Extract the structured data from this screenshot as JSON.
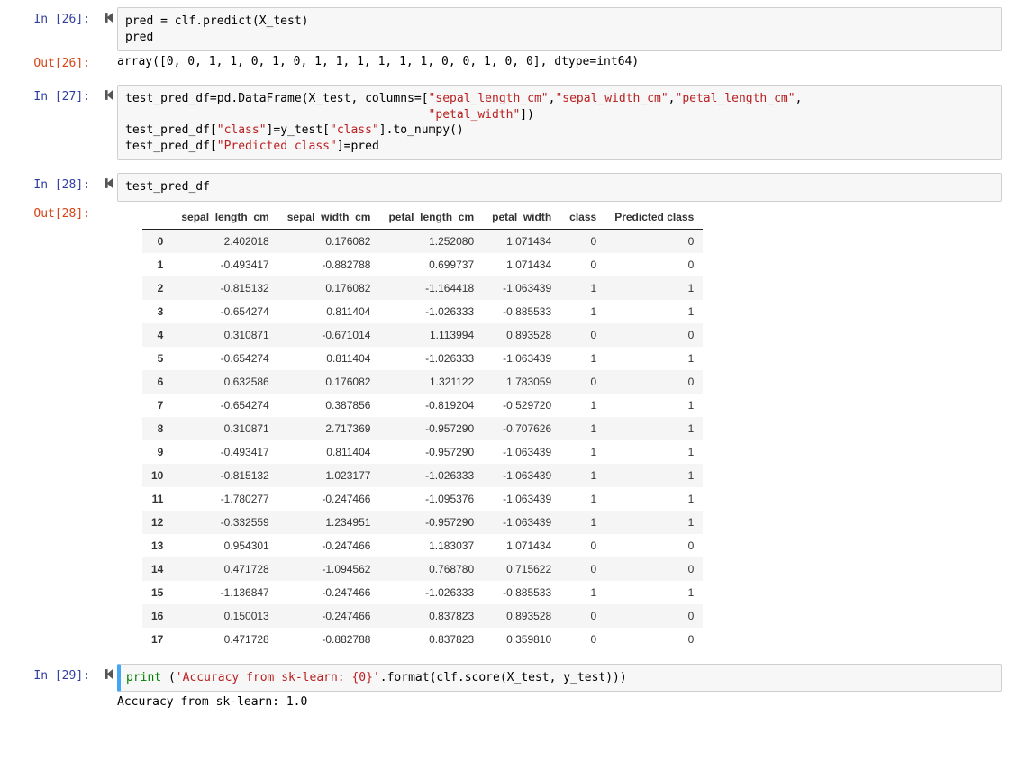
{
  "cells": {
    "c26": {
      "in_prompt": "In [26]:",
      "code_html": "pred = clf.predict(X_test)\npred",
      "out_prompt": "Out[26]:",
      "out_text": "array([0, 0, 1, 1, 0, 1, 0, 1, 1, 1, 1, 1, 1, 0, 0, 1, 0, 0], dtype=int64)"
    },
    "c27": {
      "in_prompt": "In [27]:",
      "code_html": "test_pred_df=pd.DataFrame(X_test, columns=[<span class=\"tok-str\">\"sepal_length_cm\"</span>,<span class=\"tok-str\">\"sepal_width_cm\"</span>,<span class=\"tok-str\">\"petal_length_cm\"</span>,\n                                           <span class=\"tok-str\">\"petal_width\"</span>])\ntest_pred_df[<span class=\"tok-str\">\"class\"</span>]=y_test[<span class=\"tok-str\">\"class\"</span>].to_numpy()\ntest_pred_df[<span class=\"tok-str\">\"Predicted class\"</span>]=pred"
    },
    "c28": {
      "in_prompt": "In [28]:",
      "code_html": "test_pred_df",
      "out_prompt": "Out[28]:",
      "table": {
        "columns": [
          "sepal_length_cm",
          "sepal_width_cm",
          "petal_length_cm",
          "petal_width",
          "class",
          "Predicted class"
        ],
        "index": [
          "0",
          "1",
          "2",
          "3",
          "4",
          "5",
          "6",
          "7",
          "8",
          "9",
          "10",
          "11",
          "12",
          "13",
          "14",
          "15",
          "16",
          "17"
        ],
        "data": [
          [
            "2.402018",
            "0.176082",
            "1.252080",
            "1.071434",
            "0",
            "0"
          ],
          [
            "-0.493417",
            "-0.882788",
            "0.699737",
            "1.071434",
            "0",
            "0"
          ],
          [
            "-0.815132",
            "0.176082",
            "-1.164418",
            "-1.063439",
            "1",
            "1"
          ],
          [
            "-0.654274",
            "0.811404",
            "-1.026333",
            "-0.885533",
            "1",
            "1"
          ],
          [
            "0.310871",
            "-0.671014",
            "1.113994",
            "0.893528",
            "0",
            "0"
          ],
          [
            "-0.654274",
            "0.811404",
            "-1.026333",
            "-1.063439",
            "1",
            "1"
          ],
          [
            "0.632586",
            "0.176082",
            "1.321122",
            "1.783059",
            "0",
            "0"
          ],
          [
            "-0.654274",
            "0.387856",
            "-0.819204",
            "-0.529720",
            "1",
            "1"
          ],
          [
            "0.310871",
            "2.717369",
            "-0.957290",
            "-0.707626",
            "1",
            "1"
          ],
          [
            "-0.493417",
            "0.811404",
            "-0.957290",
            "-1.063439",
            "1",
            "1"
          ],
          [
            "-0.815132",
            "1.023177",
            "-1.026333",
            "-1.063439",
            "1",
            "1"
          ],
          [
            "-1.780277",
            "-0.247466",
            "-1.095376",
            "-1.063439",
            "1",
            "1"
          ],
          [
            "-0.332559",
            "1.234951",
            "-0.957290",
            "-1.063439",
            "1",
            "1"
          ],
          [
            "0.954301",
            "-0.247466",
            "1.183037",
            "1.071434",
            "0",
            "0"
          ],
          [
            "0.471728",
            "-1.094562",
            "0.768780",
            "0.715622",
            "0",
            "0"
          ],
          [
            "-1.136847",
            "-0.247466",
            "-1.026333",
            "-0.885533",
            "1",
            "1"
          ],
          [
            "0.150013",
            "-0.247466",
            "0.837823",
            "0.893528",
            "0",
            "0"
          ],
          [
            "0.471728",
            "-0.882788",
            "0.837823",
            "0.359810",
            "0",
            "0"
          ]
        ]
      }
    },
    "c29": {
      "in_prompt": "In [29]:",
      "code_html": "<span class=\"tok-builtin\">print</span> (<span class=\"tok-str\">'Accuracy from sk-learn: {0}'</span>.format(clf.score(X_test, y_test)))",
      "out_text": "Accuracy from sk-learn: 1.0"
    }
  }
}
